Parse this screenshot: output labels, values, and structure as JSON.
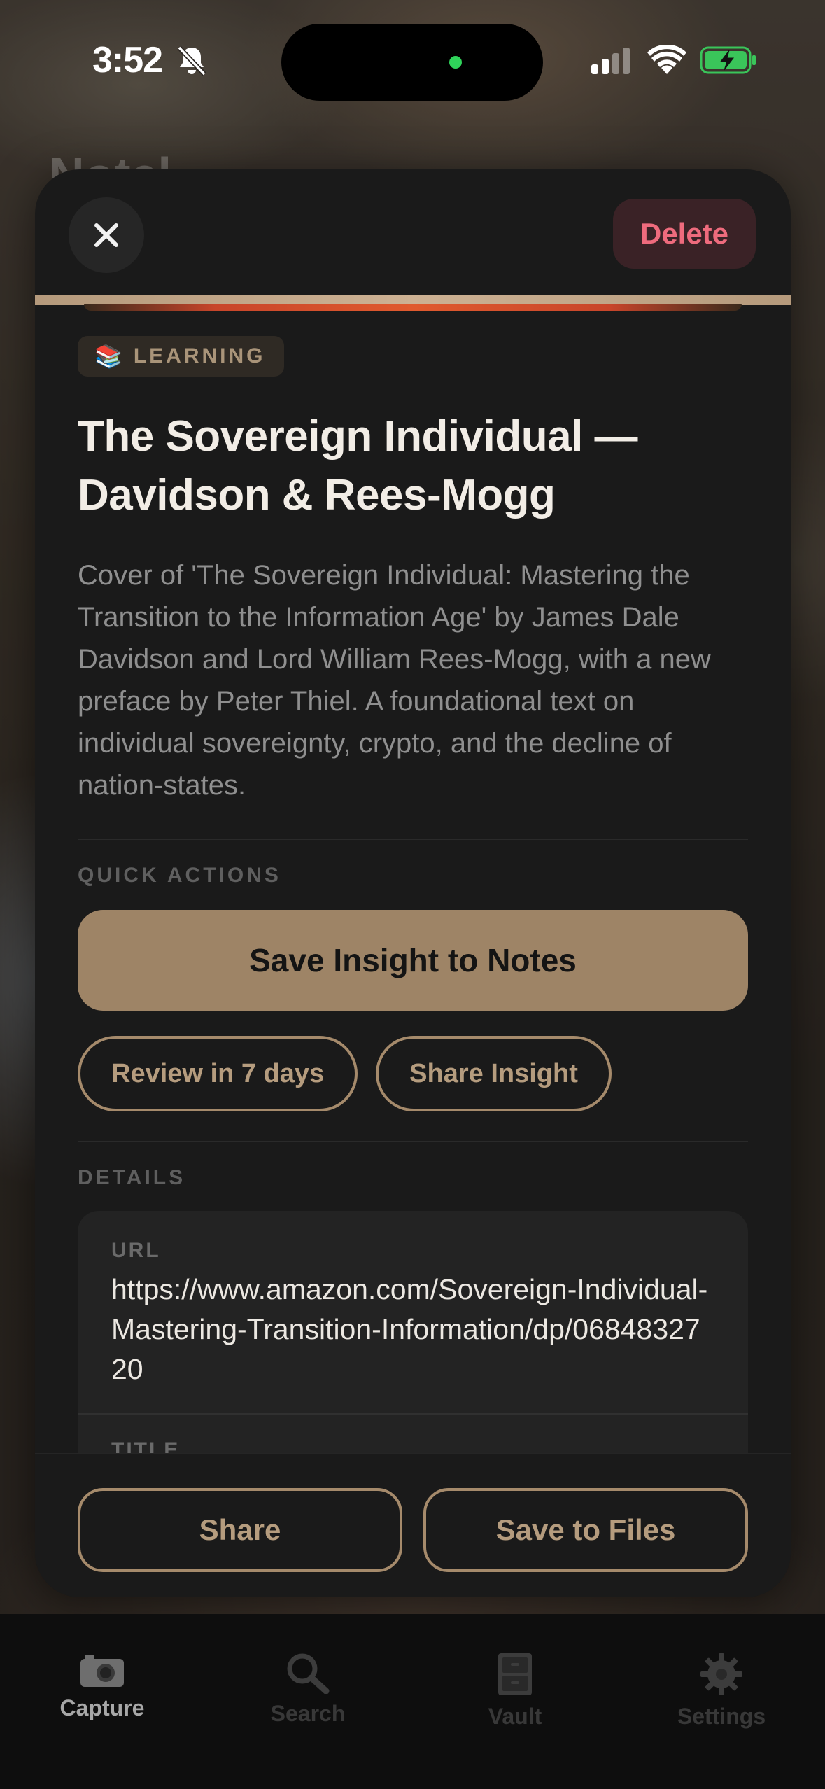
{
  "status_bar": {
    "time": "3:52"
  },
  "background": {
    "title_fragment": "Notel"
  },
  "sheet": {
    "delete_label": "Delete",
    "badge": {
      "emoji": "📚",
      "label": "LEARNING"
    },
    "title": "The Sovereign Individual — Davidson & Rees-Mogg",
    "description": "Cover of 'The Sovereign Individual: Mastering the Transition to the Information Age' by James Dale Davidson and Lord William Rees-Mogg, with a new preface by Peter Thiel. A foundational text on individual sovereignty, crypto, and the decline of nation-states.",
    "quick_actions": {
      "label": "QUICK ACTIONS",
      "primary": "Save Insight to Notes",
      "secondary": [
        "Review in 7 days",
        "Share Insight"
      ]
    },
    "details": {
      "label": "DETAILS",
      "fields": [
        {
          "label": "URL",
          "value": "https://www.amazon.com/Sovereign-Individual-Mastering-Transition-Information/dp/0684832720"
        },
        {
          "label": "TITLE",
          "value": ""
        }
      ]
    },
    "footer": {
      "share": "Share",
      "save_to_files": "Save to Files"
    }
  },
  "tabbar": {
    "tabs": [
      {
        "label": "Capture",
        "icon": "camera-icon",
        "active": true
      },
      {
        "label": "Search",
        "icon": "magnifier-icon",
        "active": false
      },
      {
        "label": "Vault",
        "icon": "file-cabinet-icon",
        "active": false
      },
      {
        "label": "Settings",
        "icon": "gear-icon",
        "active": false
      }
    ]
  },
  "colors": {
    "accent": "#9e8466",
    "delete": "#ee6b7d",
    "sheet_bg": "#1a1a1a"
  }
}
